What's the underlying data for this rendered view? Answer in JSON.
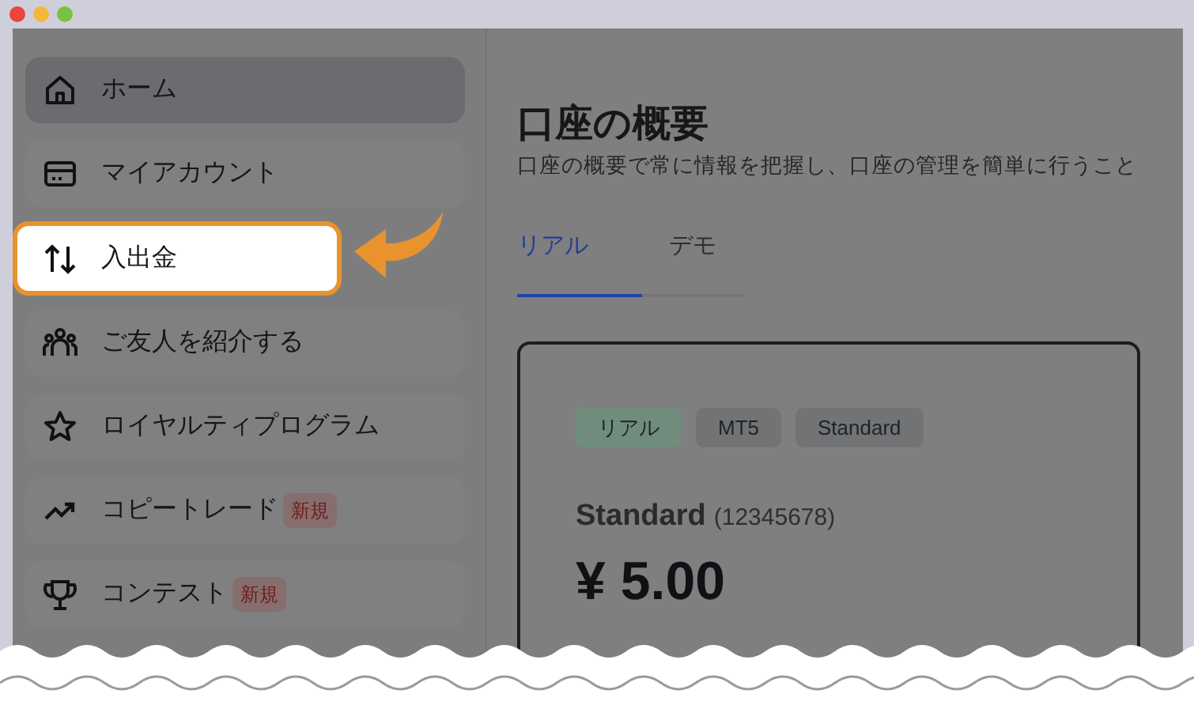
{
  "sidebar": {
    "items": [
      {
        "label": "ホーム",
        "selected": true,
        "highlighted": false
      },
      {
        "label": "マイアカウント",
        "selected": false,
        "highlighted": false
      },
      {
        "label": "入出金",
        "selected": false,
        "highlighted": true
      },
      {
        "label": "ご友人を紹介する",
        "selected": false,
        "highlighted": false
      },
      {
        "label": "ロイヤルティプログラム",
        "selected": false,
        "highlighted": false
      },
      {
        "label": "コピートレード",
        "badge": "新規",
        "selected": false,
        "highlighted": false
      },
      {
        "label": "コンテスト",
        "badge": "新規",
        "selected": false,
        "highlighted": false
      }
    ]
  },
  "main": {
    "title": "口座の概要",
    "subtitle": "口座の概要で常に情報を把握し、口座の管理を簡単に行うこと",
    "tabs": [
      {
        "label": "リアル",
        "selected": true
      },
      {
        "label": "デモ",
        "selected": false
      }
    ],
    "card": {
      "tags": [
        {
          "label": "リアル",
          "color": "#6f8c7c"
        },
        {
          "label": "MT5",
          "color": "#727375"
        },
        {
          "label": "Standard",
          "color": "#727375"
        }
      ],
      "account_name": "Standard",
      "account_number": "(12345678)",
      "balance": "¥ 5.00"
    }
  }
}
